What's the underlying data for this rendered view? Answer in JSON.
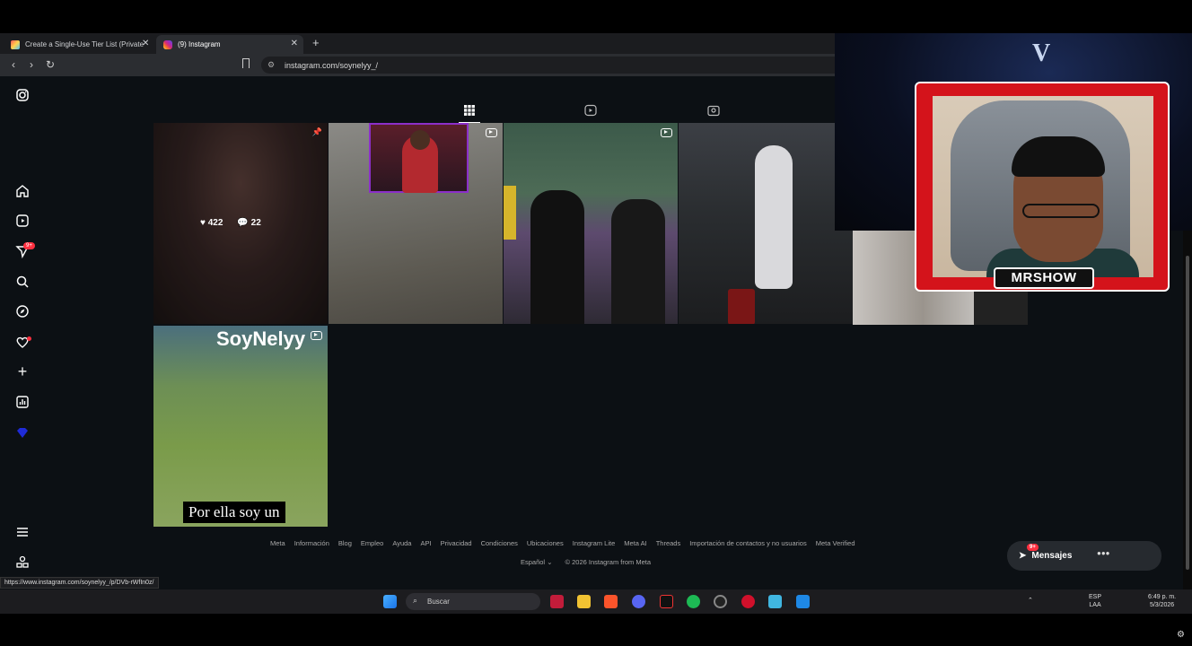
{
  "browser": {
    "tabs": [
      {
        "label": "Create a Single-Use Tier List (Private",
        "close": "✕"
      },
      {
        "label": "(9) Instagram",
        "close": "✕"
      }
    ],
    "new_tab": "+",
    "url": "instagram.com/soynelyy_/",
    "status_url": "https://www.instagram.com/soynelyy_/p/DVb-rWfIn0z/"
  },
  "sidebar": {
    "icons": [
      "instagram-icon",
      "home-icon",
      "reels-icon",
      "direct-icon",
      "search-icon",
      "explore-icon",
      "notifications-icon",
      "create-icon",
      "dashboard-icon",
      "profile-icon",
      "menu-icon",
      "more-icon"
    ],
    "direct_badge": "9+"
  },
  "profile": {
    "tabs": [
      "posts-grid",
      "reels",
      "tagged"
    ],
    "posts": [
      {
        "likes": "422",
        "comments": "22"
      }
    ],
    "post6_title": "SoyNelyy",
    "post6_caption": "Por ella soy un"
  },
  "footer": {
    "links": [
      "Meta",
      "Información",
      "Blog",
      "Empleo",
      "Ayuda",
      "API",
      "Privacidad",
      "Condiciones",
      "Ubicaciones",
      "Instagram Lite",
      "Meta AI",
      "Threads",
      "Importación de contactos y no usuarios",
      "Meta Verified"
    ],
    "language": "Español",
    "copyright": "© 2026 Instagram from Meta"
  },
  "messages": {
    "label": "Mensajes",
    "badge": "9+"
  },
  "taskbar": {
    "search_placeholder": "Buscar",
    "lang_top": "ESP",
    "lang_bottom": "LAA",
    "time": "6:49 p. m.",
    "date": "5/3/2026"
  },
  "webcam": {
    "name_plate": "MRSHOW",
    "logo": "V"
  }
}
